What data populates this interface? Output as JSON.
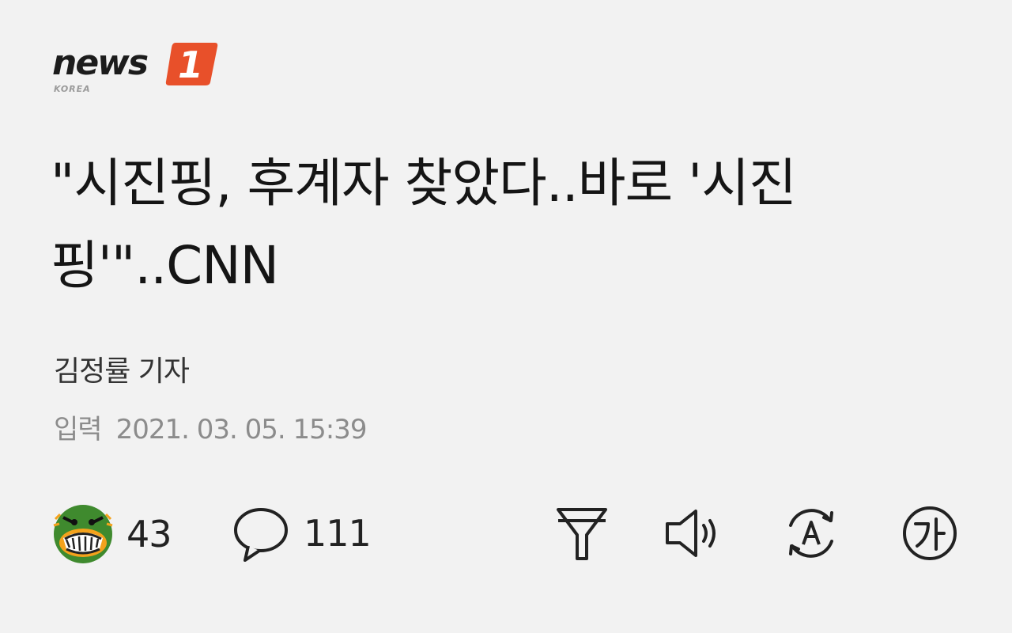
{
  "brand": {
    "wordmark": "news",
    "badge_numeral": "1",
    "subtitle": "KOREA",
    "accent_color": "#e8502a"
  },
  "article": {
    "headline": "\"시진핑, 후계자 찾았다..바로 '시진핑'\"..CNN",
    "reporter": "김정률 기자",
    "date_label": "입력",
    "date_value": "2021. 03. 05. 15:39"
  },
  "actions": {
    "reaction_count": "43",
    "comment_count": "111",
    "tools": [
      {
        "name": "summary-filter-icon"
      },
      {
        "name": "speaker-icon"
      },
      {
        "name": "translate-icon"
      },
      {
        "name": "font-size-icon"
      }
    ]
  }
}
